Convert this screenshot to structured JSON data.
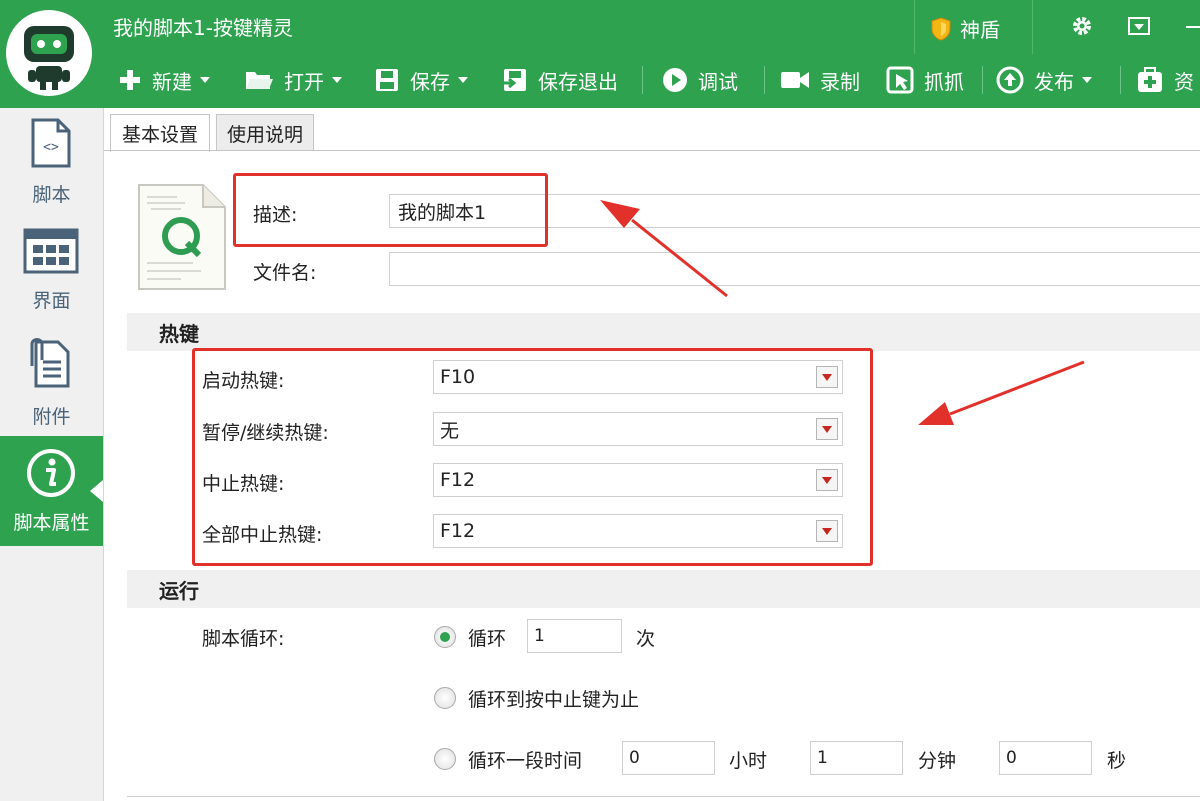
{
  "window": {
    "title": "我的脚本1-按键精灵",
    "shield_label": "神盾"
  },
  "toolbar": {
    "new_label": "新建",
    "open_label": "打开",
    "save_label": "保存",
    "save_exit_label": "保存退出",
    "debug_label": "调试",
    "record_label": "录制",
    "capture_label": "抓抓",
    "publish_label": "发布",
    "resource_label": "资"
  },
  "sidebar": {
    "items": [
      {
        "label": "脚本",
        "icon": "script-file-icon"
      },
      {
        "label": "界面",
        "icon": "interface-grid-icon"
      },
      {
        "label": "附件",
        "icon": "attachment-icon"
      },
      {
        "label": "脚本属性",
        "icon": "info-icon",
        "active": true
      }
    ]
  },
  "tabs": [
    {
      "label": "基本设置",
      "active": true
    },
    {
      "label": "使用说明",
      "active": false
    }
  ],
  "basic": {
    "description_label": "描述:",
    "description_value": "我的脚本1",
    "filename_label": "文件名:",
    "filename_value": ""
  },
  "hotkeys": {
    "section_title": "热键",
    "rows": [
      {
        "label": "启动热键:",
        "value": "F10"
      },
      {
        "label": "暂停/继续热键:",
        "value": "无"
      },
      {
        "label": "中止热键:",
        "value": "F12"
      },
      {
        "label": "全部中止热键:",
        "value": "F12"
      }
    ]
  },
  "run": {
    "section_title": "运行",
    "loop_label": "脚本循环:",
    "option_loop": "循环",
    "loop_count": "1",
    "times_unit": "次",
    "option_until_stop": "循环到按中止键为止",
    "option_duration": "循环一段时间",
    "hours": "0",
    "hours_unit": "小时",
    "minutes": "1",
    "minutes_unit": "分钟",
    "seconds": "0",
    "seconds_unit": "秒"
  },
  "colors": {
    "brand": "#2ea24f",
    "highlight": "#e2312b"
  }
}
